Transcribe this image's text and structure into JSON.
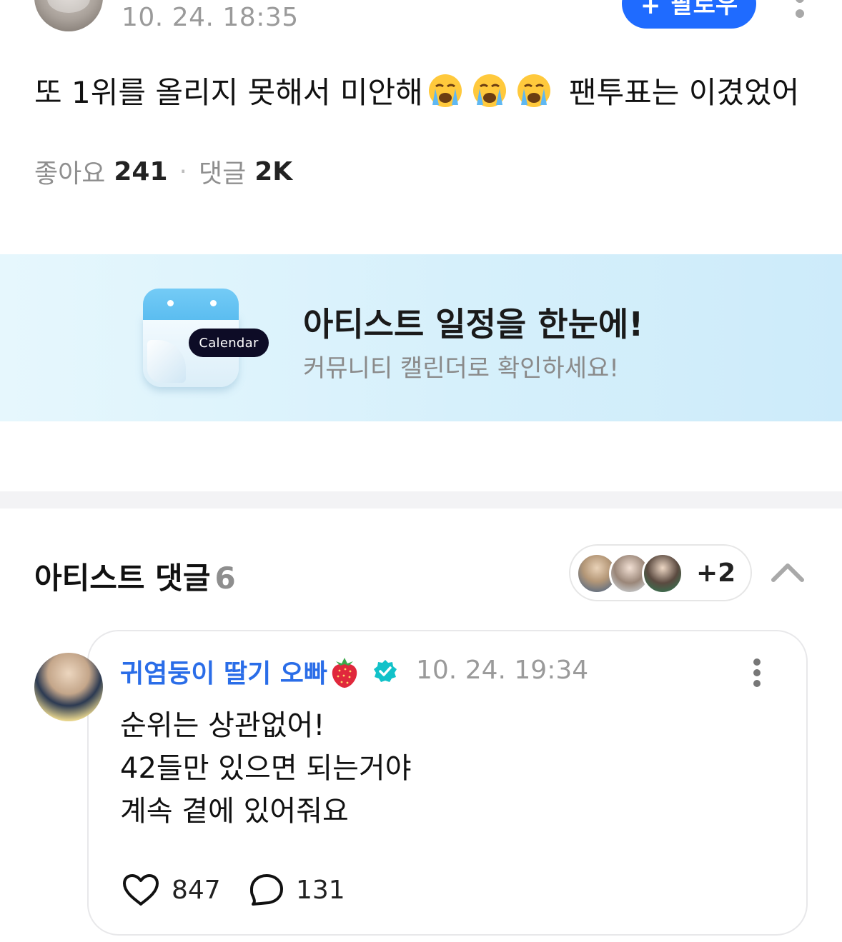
{
  "post": {
    "timestamp": "10. 24. 18:35",
    "follow_label": "팔로우",
    "body_start": "또 1위를 올리지 못해서 미안해",
    "body_emojis": [
      "loudly-crying-face",
      "loudly-crying-face",
      "loudly-crying-face"
    ],
    "body_end": "팬투표는 이겼었어",
    "likes_label": "좋아요",
    "likes_count": "241",
    "comments_label": "댓글",
    "comments_count": "2K"
  },
  "banner": {
    "badge": "Calendar",
    "title": "아티스트 일정을 한눈에!",
    "subtitle": "커뮤니티 캘린더로 확인하세요!"
  },
  "artist_comments": {
    "title": "아티스트 댓글",
    "count": "6",
    "more_artists": "+2",
    "comment": {
      "author": "귀염둥이 딸기 오빠",
      "timestamp": "10. 24. 19:34",
      "lines": [
        "순위는 상관없어!",
        "42들만 있으면 되는거야",
        "계속 곁에 있어줘요"
      ],
      "likes": "847",
      "replies": "131"
    }
  },
  "colors": {
    "accent": "#1f6bff",
    "author": "#2a6de8",
    "verified": "#12c2c9",
    "banner_bg": "#d6f0fb"
  }
}
